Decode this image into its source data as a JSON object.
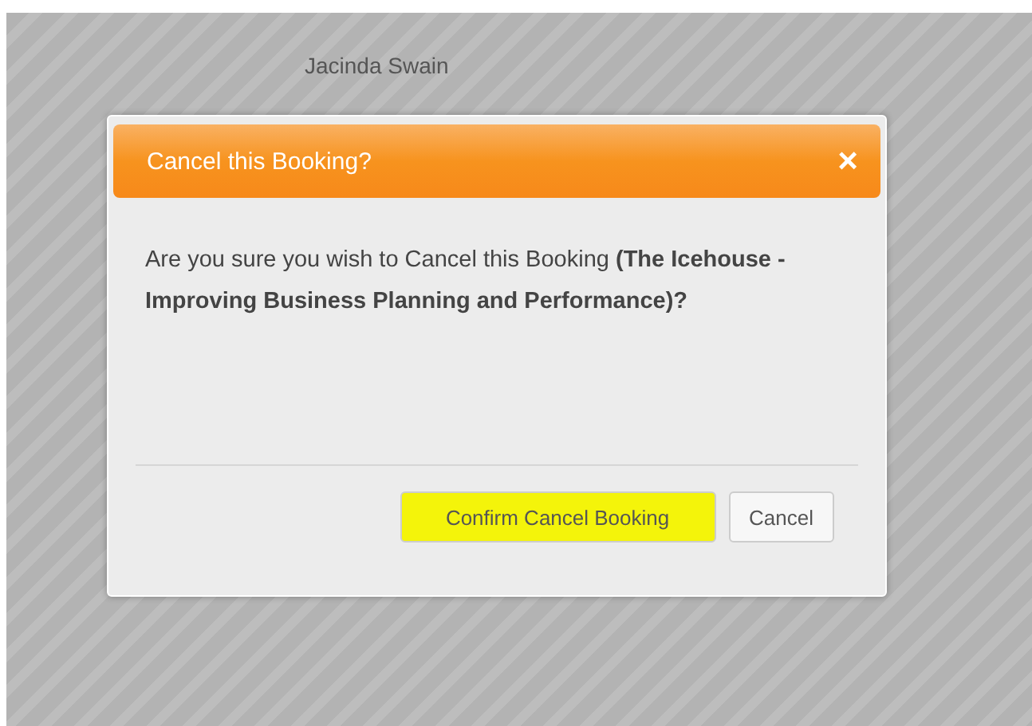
{
  "background": {
    "name": "Jacinda Swain"
  },
  "dialog": {
    "title": "Cancel this Booking?",
    "close": "×",
    "message": "Are you sure you wish to Cancel this Booking **(The Icehouse - Improving Business Planning and Performance)?**",
    "buttons": [
      {
        "label": "Confirm Cancel Booking",
        "highlighted": true
      },
      {
        "label": "Cancel",
        "highlighted": false
      }
    ]
  }
}
